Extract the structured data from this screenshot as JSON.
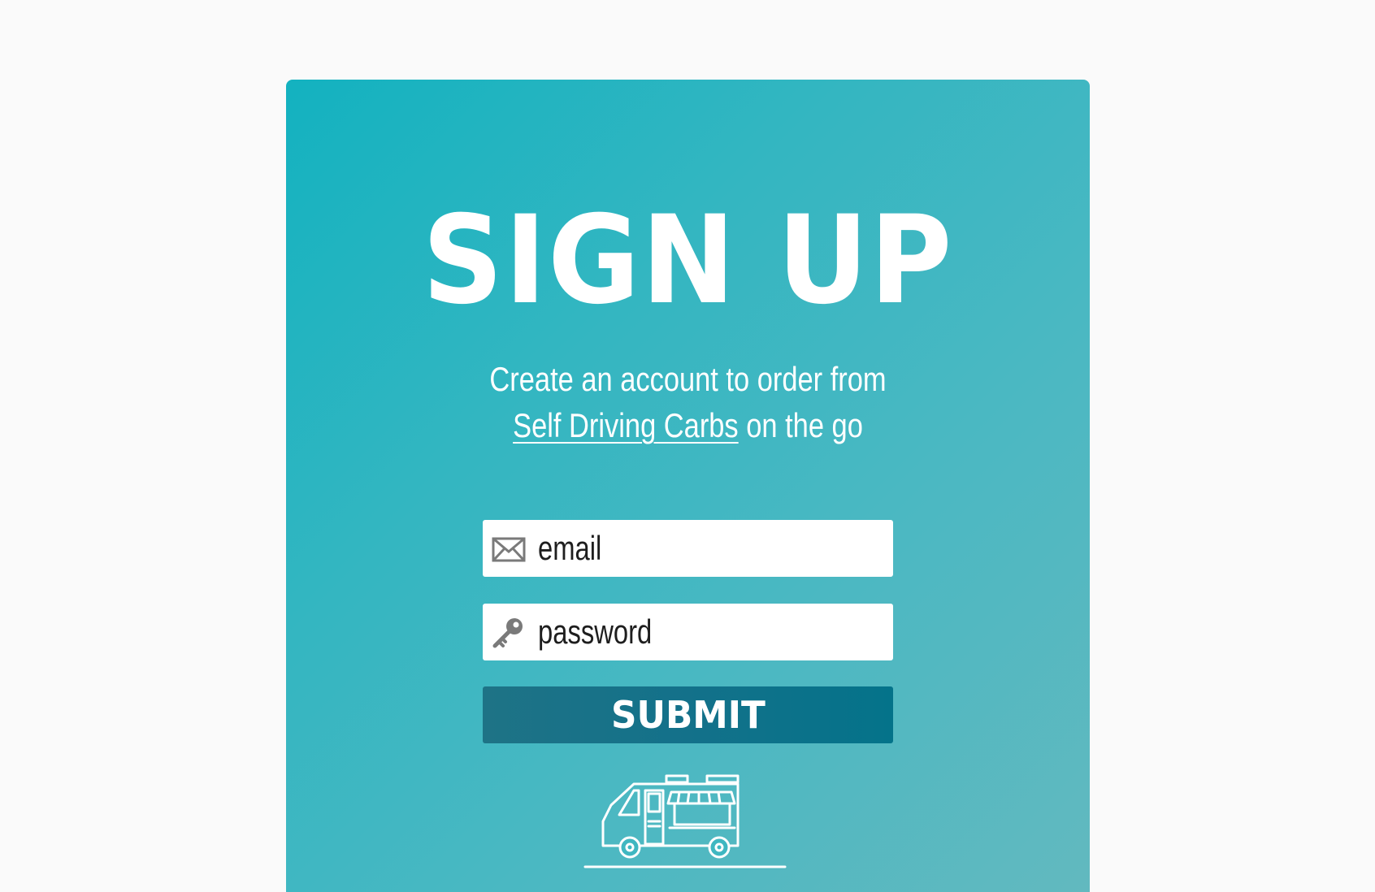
{
  "signup": {
    "title": "SIGN UP",
    "subtitle_line1": "Create an account to order from",
    "brand_link": "Self Driving Carbs",
    "subtitle_line2_suffix": " on the go",
    "email_placeholder": "email",
    "password_placeholder": "password",
    "submit_label": "SUBMIT"
  },
  "icons": {
    "email": "envelope-icon",
    "password": "key-icon",
    "footer": "food-truck-icon"
  },
  "colors": {
    "card_gradient_start": "#13b2c0",
    "card_gradient_end": "#62b9bf",
    "submit_button": "#13718a",
    "page_background": "#fafafa"
  }
}
